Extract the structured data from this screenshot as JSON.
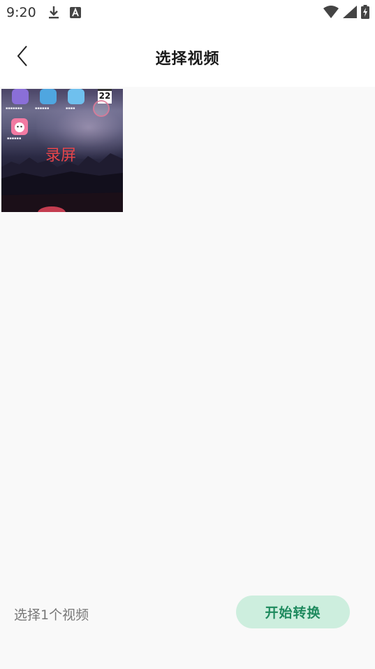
{
  "status_bar": {
    "time": "9:20",
    "left_icons": [
      "download-icon",
      "notification-a-icon"
    ],
    "right_icons": [
      "wifi-icon",
      "signal-icon",
      "battery-charging-icon"
    ]
  },
  "header": {
    "back_icon": "chevron-left-icon",
    "title": "选择视频"
  },
  "videos": [
    {
      "selected": true,
      "watermark": "录屏",
      "calendar_day": "22"
    }
  ],
  "footer": {
    "selection_count": "选择1个视频",
    "start_button_label": "开始转换"
  },
  "colors": {
    "content_bg": "#f9f9f9",
    "button_bg": "#cdeede",
    "button_text": "#1e8a5e",
    "watermark": "#e8454a"
  }
}
